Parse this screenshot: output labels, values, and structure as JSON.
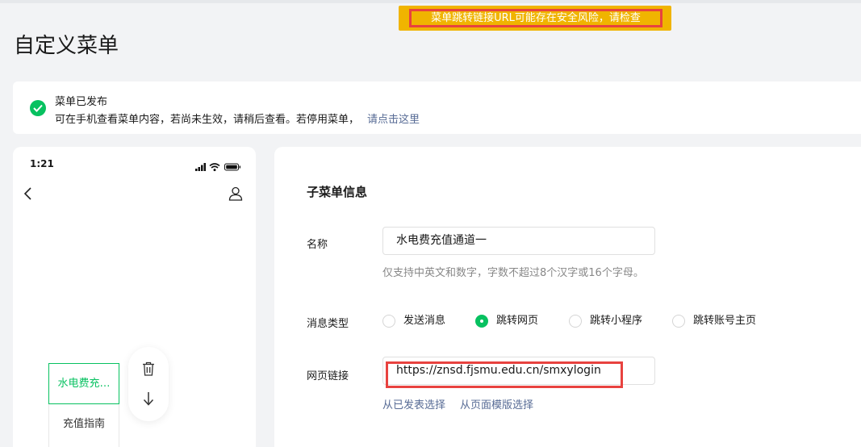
{
  "warning": {
    "text": "菜单跳转链接URL可能存在安全风险，请检查"
  },
  "page": {
    "title": "自定义菜单"
  },
  "notice": {
    "title": "菜单已发布",
    "text": "可在手机查看菜单内容，若尚未生效，请稍后查看。若停用菜单，",
    "link": "请点击这里"
  },
  "phone": {
    "time": "1:21",
    "submenu": {
      "active": "水电费充…",
      "item": "充值指南"
    }
  },
  "form": {
    "section_title": "子菜单信息",
    "name_label": "名称",
    "name_value": "水电费充值通道一",
    "name_hint": "仅支持中英文和数字，字数不超过8个汉字或16个字母。",
    "type_label": "消息类型",
    "types": [
      {
        "label": "发送消息",
        "checked": false
      },
      {
        "label": "跳转网页",
        "checked": true
      },
      {
        "label": "跳转小程序",
        "checked": false
      },
      {
        "label": "跳转账号主页",
        "checked": false
      }
    ],
    "url_label": "网页链接",
    "url_value": "https://znsd.fjsmu.edu.cn/smxylogin",
    "select_published": "从已发表选择",
    "select_template": "从页面模版选择"
  },
  "colors": {
    "accent": "#07c160",
    "warning": "#f0b400",
    "highlight": "#e8423f",
    "link": "#576b95"
  }
}
